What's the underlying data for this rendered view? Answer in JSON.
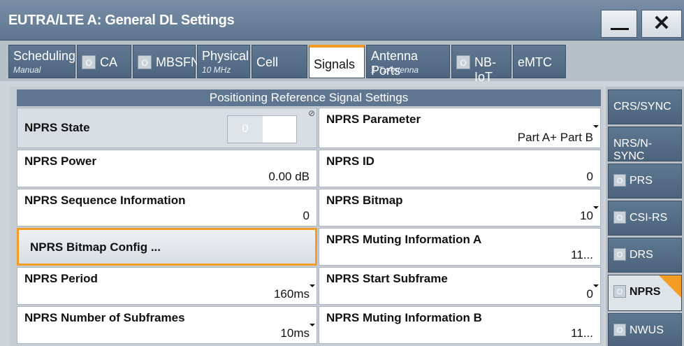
{
  "window": {
    "title": "EUTRA/LTE A: General DL Settings",
    "minimize_symbol": "",
    "close_symbol": "✕"
  },
  "tabs": [
    {
      "label": "Scheduling",
      "sub": "Manual",
      "led": false
    },
    {
      "label": "CA",
      "sub": "",
      "led": true,
      "led_text": "O"
    },
    {
      "label": "MBSFN",
      "sub": "",
      "led": true,
      "led_text": "O"
    },
    {
      "label": "Physical",
      "sub": "10 MHz",
      "led": false
    },
    {
      "label": "Cell",
      "sub": "",
      "led": false
    },
    {
      "label": "Signals",
      "sub": "",
      "led": false,
      "active": true
    },
    {
      "label": "Antenna Ports",
      "sub": "1 TxAntenna",
      "led": false
    },
    {
      "label": "NB-IoT",
      "sub": "",
      "led": true,
      "led_text": "O"
    },
    {
      "label": "eMTC",
      "sub": "",
      "led": false
    }
  ],
  "section": {
    "header": "Positioning Reference Signal Settings"
  },
  "fields": {
    "nprs_state": {
      "label": "NPRS State",
      "toggle_text": "0"
    },
    "nprs_parameter": {
      "label": "NPRS Parameter",
      "value": "Part A+ Part B"
    },
    "nprs_power": {
      "label": "NPRS Power",
      "value": "0.00 dB"
    },
    "nprs_id": {
      "label": "NPRS ID",
      "value": "0"
    },
    "nprs_sequence_information": {
      "label": "NPRS Sequence Information",
      "value": "0"
    },
    "nprs_bitmap": {
      "label": "NPRS Bitmap",
      "value": "10"
    },
    "nprs_bitmap_config": {
      "label": "NPRS Bitmap Config ..."
    },
    "nprs_muting_a": {
      "label": "NPRS Muting Information A",
      "value": "11..."
    },
    "nprs_period": {
      "label": "NPRS Period",
      "value": "160ms"
    },
    "nprs_start_subframe": {
      "label": "NPRS Start Subframe",
      "value": "0"
    },
    "nprs_number_subframes": {
      "label": "NPRS Number of Subframes",
      "value": "10ms"
    },
    "nprs_muting_b": {
      "label": "NPRS Muting Information B",
      "value": "11..."
    }
  },
  "sidebar": [
    {
      "label": "CRS/SYNC",
      "led": false
    },
    {
      "label": "NRS/N-SYNC",
      "led": false
    },
    {
      "label": "PRS",
      "led": true,
      "led_text": "O"
    },
    {
      "label": "CSI-RS",
      "led": true,
      "led_text": "O"
    },
    {
      "label": "DRS",
      "led": true,
      "led_text": "O"
    },
    {
      "label": "NPRS",
      "led": true,
      "led_text": "O",
      "active": true
    },
    {
      "label": "NWUS",
      "led": true,
      "led_text": "O"
    }
  ],
  "colors": {
    "accent": "#f39c26",
    "title_bar": "#5d7590",
    "tab_bg": "#4d657e",
    "panel_bg": "#c6cdd5"
  }
}
